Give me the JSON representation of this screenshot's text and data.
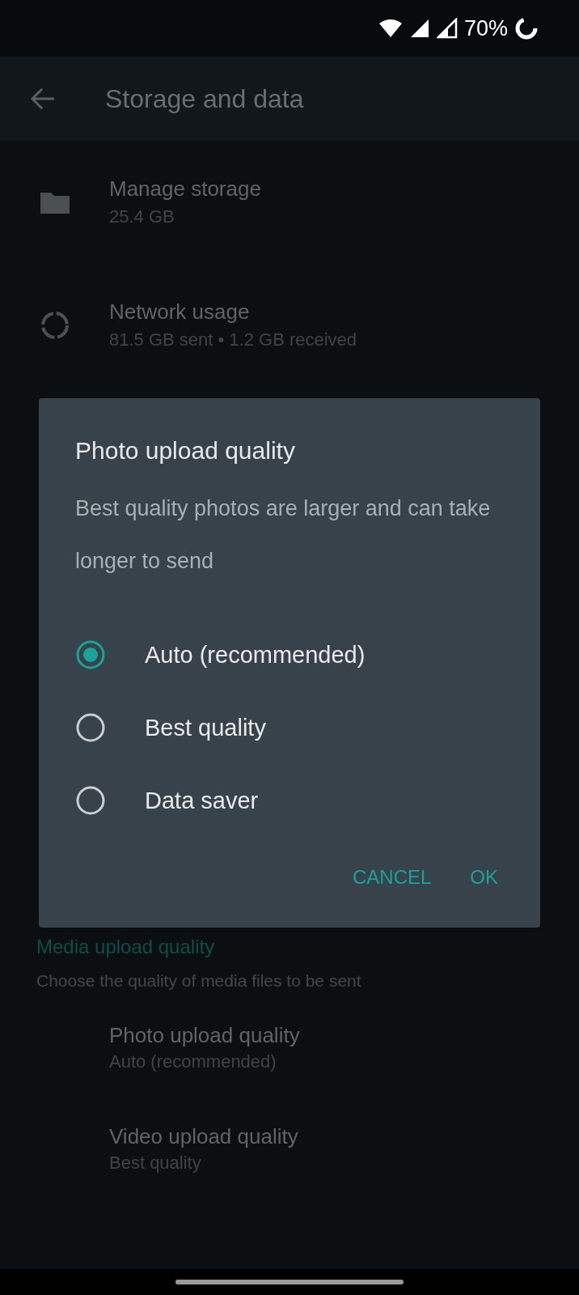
{
  "status_bar": {
    "battery": "70%"
  },
  "app_bar": {
    "title": "Storage and data"
  },
  "settings": [
    {
      "kind": "folder",
      "title": "Manage storage",
      "subtitle": "25.4 GB"
    },
    {
      "kind": "network",
      "title": "Network usage",
      "subtitle": "81.5 GB sent • 1.2 GB received"
    }
  ],
  "media_section": {
    "header": "Media upload quality",
    "description": "Choose the quality of media files to be sent",
    "items": [
      {
        "title": "Photo upload quality",
        "subtitle": "Auto (recommended)"
      },
      {
        "title": "Video upload quality",
        "subtitle": "Best quality"
      }
    ]
  },
  "dialog": {
    "title": "Photo upload quality",
    "message": "Best quality photos are larger and can take longer to send",
    "options": [
      {
        "label": "Auto (recommended)",
        "selected": true
      },
      {
        "label": "Best quality",
        "selected": false
      },
      {
        "label": "Data saver",
        "selected": false
      }
    ],
    "buttons": [
      "CANCEL",
      "OK"
    ]
  }
}
